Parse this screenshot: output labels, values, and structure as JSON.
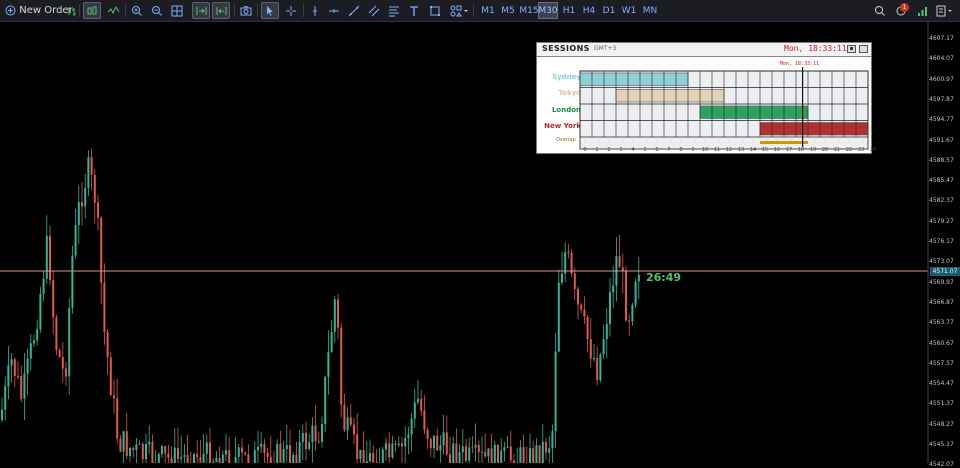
{
  "toolbar": {
    "new_order_label": "New Order",
    "timeframes": [
      "M1",
      "M5",
      "M15",
      "M30",
      "H1",
      "H4",
      "D1",
      "W1",
      "MN"
    ],
    "selected_timeframe": "M30",
    "notification_count": "1"
  },
  "chart": {
    "current_price_label": "4571.07",
    "bar_countdown": "26:49",
    "price_axis_labels": [
      "4607.17",
      "4604.07",
      "4600.97",
      "4597.87",
      "4594.77",
      "4591.67",
      "4588.57",
      "4585.47",
      "4582.37",
      "4579.27",
      "4576.17",
      "4573.07",
      "4569.97",
      "4566.87",
      "4563.77",
      "4560.67",
      "4557.57",
      "4554.47",
      "4551.37",
      "4548.27",
      "4545.17",
      "4542.07"
    ]
  },
  "sessions_panel": {
    "title": "SESSIONS",
    "timezone": "GMT+3",
    "time": "Mon, 18:33:11",
    "cursor_time": "Mon, 18:33:11",
    "overlap_label": "Overlap",
    "hours": [
      "0",
      "1",
      "2",
      "3",
      "4",
      "5",
      "6",
      "7",
      "8",
      "9",
      "10",
      "11",
      "12",
      "13",
      "14",
      "15",
      "16",
      "17",
      "18",
      "19",
      "20",
      "21",
      "22",
      "23",
      "24"
    ],
    "sessions": [
      {
        "name": "Sydney",
        "color": "#8ecfd8",
        "label_color": "#8ecfd8",
        "start": 0,
        "end": 9
      },
      {
        "name": "Tokyo",
        "color": "#e2d2b8",
        "label_color": "#d9c2a0",
        "start": 3,
        "end": 12
      },
      {
        "name": "London",
        "color": "#2ea060",
        "label_color": "#1f8a4a",
        "start": 10,
        "end": 19
      },
      {
        "name": "New York",
        "color": "#b33030",
        "label_color": "#b22a2a",
        "start": 15,
        "end": 24
      }
    ],
    "overlap": {
      "start": 15,
      "end": 19,
      "color": "#c89b00"
    },
    "current_hour": 18.55
  },
  "colors": {
    "bull": "#2fb79a",
    "bear": "#e0584f",
    "price_line": "#d39c8a",
    "toolbar_bg": "#1b1d22",
    "chart_bg": "#000000"
  }
}
